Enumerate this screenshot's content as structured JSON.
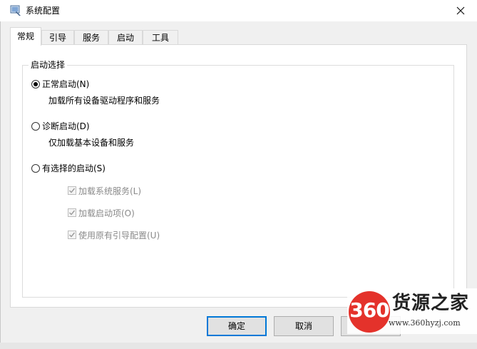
{
  "window": {
    "title": "系统配置",
    "icons": {
      "app": "msconfig-icon",
      "close": "close-icon"
    }
  },
  "tabs": [
    {
      "label": "常规",
      "active": true
    },
    {
      "label": "引导",
      "active": false
    },
    {
      "label": "服务",
      "active": false
    },
    {
      "label": "启动",
      "active": false
    },
    {
      "label": "工具",
      "active": false
    }
  ],
  "startup_selection": {
    "legend": "启动选择",
    "options": [
      {
        "label": "正常启动(N)",
        "description": "加载所有设备驱动程序和服务",
        "checked": true
      },
      {
        "label": "诊断启动(D)",
        "description": "仅加载基本设备和服务",
        "checked": false
      },
      {
        "label": "有选择的启动(S)",
        "checked": false
      }
    ],
    "selective_items": [
      {
        "label": "加载系统服务(L)",
        "checked": true,
        "enabled": false
      },
      {
        "label": "加载启动项(O)",
        "checked": true,
        "enabled": false
      },
      {
        "label": "使用原有引导配置(U)",
        "checked": true,
        "enabled": false
      }
    ]
  },
  "buttons": {
    "ok": "确定",
    "cancel": "取消"
  },
  "watermark": {
    "number": "360",
    "text": "货源之家",
    "url": "www.360hyzj.com"
  },
  "colors": {
    "accent": "#0078d7",
    "watermark_red": "#e4322b"
  }
}
